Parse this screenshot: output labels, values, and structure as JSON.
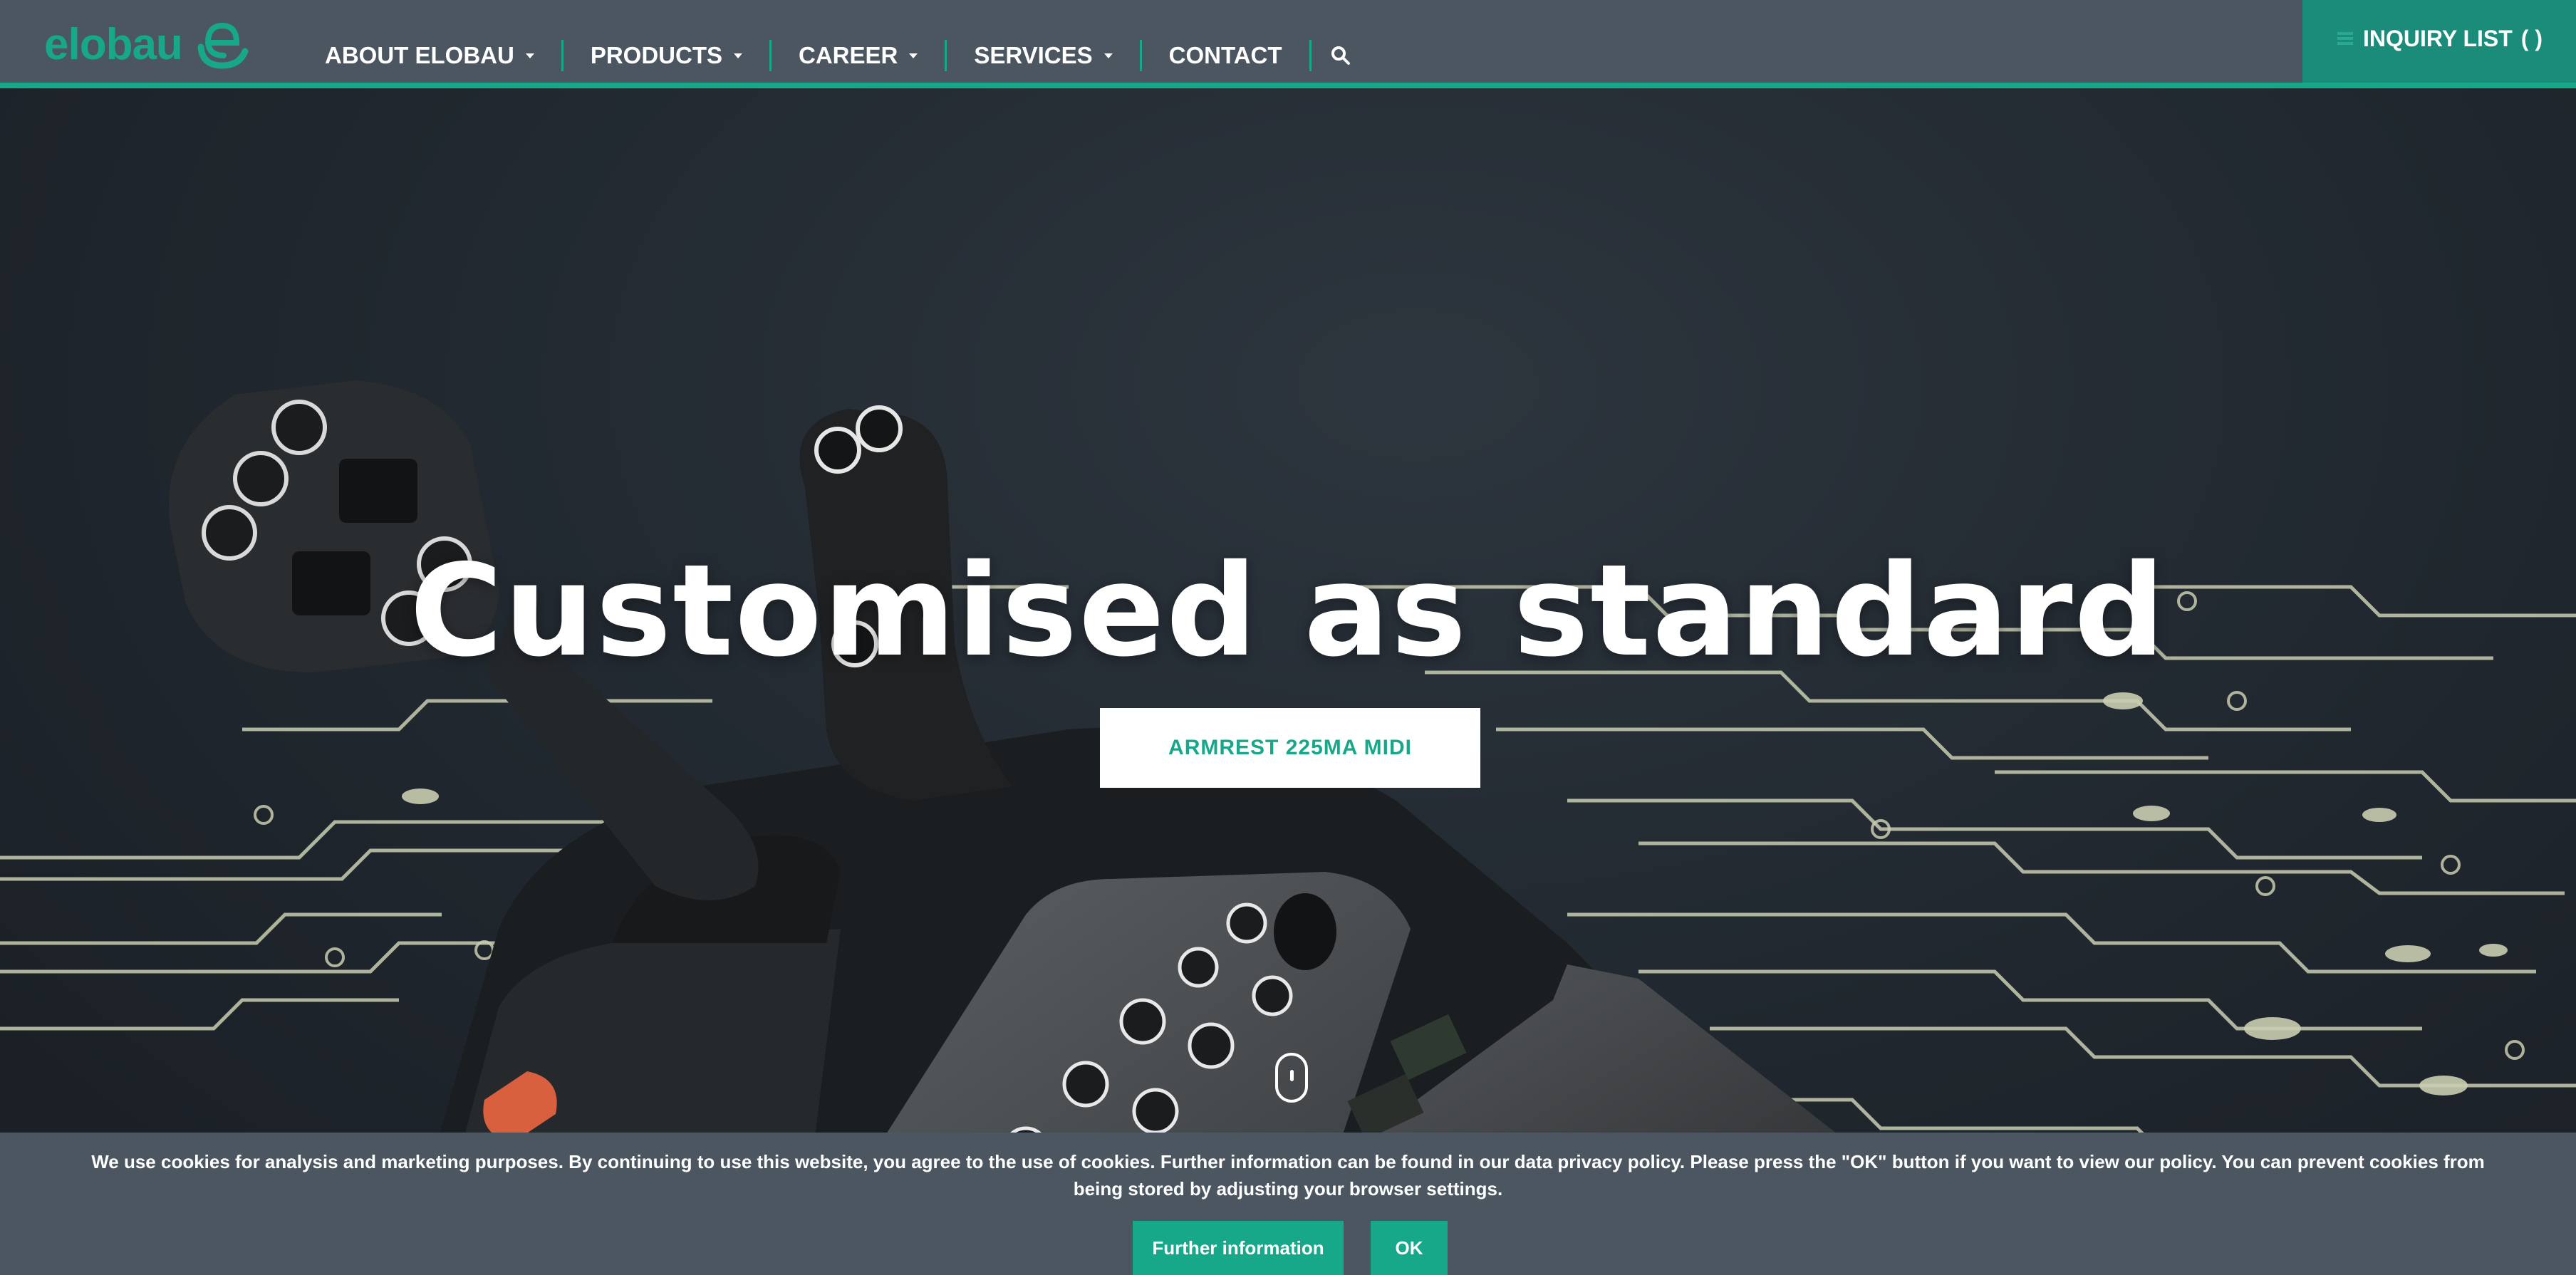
{
  "brand": {
    "name": "elobau",
    "color": "#17a88a"
  },
  "nav": {
    "items": [
      {
        "label": "ABOUT ELOBAU",
        "dropdown": true
      },
      {
        "label": "PRODUCTS",
        "dropdown": true
      },
      {
        "label": "CAREER",
        "dropdown": true
      },
      {
        "label": "SERVICES",
        "dropdown": true
      },
      {
        "label": "CONTACT",
        "dropdown": false
      }
    ],
    "search_icon": "search-icon",
    "inquiry_label": "INQUIRY LIST",
    "inquiry_count": "( )"
  },
  "hero": {
    "title": "Customised as standard",
    "button_label": "ARMREST 225MA MIDI"
  },
  "cookie": {
    "text": "We use cookies for analysis and marketing purposes. By continuing to use this website, you agree to the use of cookies. Further information can be found in our data privacy policy. Please press the \"OK\" button if you want to view our policy. You can prevent cookies from being stored by adjusting your browser settings.",
    "info_label": "Further information",
    "ok_label": "OK"
  },
  "colors": {
    "header_bg": "#4b5660",
    "accent": "#17a88a",
    "inquiry_bg": "#1a8c79",
    "hero_bg": "#1e242b",
    "circuit": "#c9cdb0"
  }
}
